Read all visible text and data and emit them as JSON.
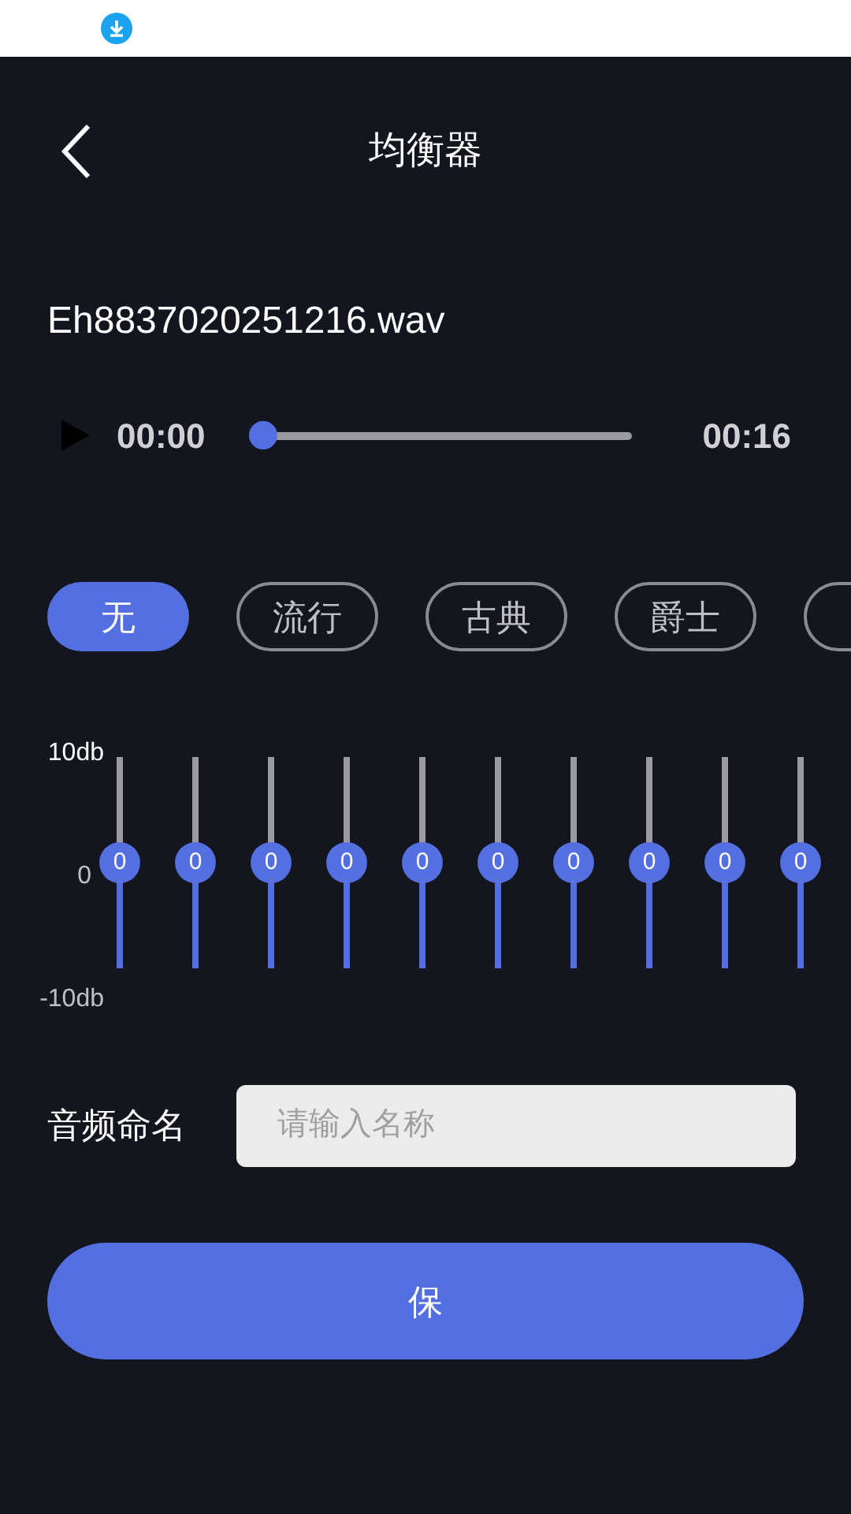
{
  "header": {
    "title": "均衡器"
  },
  "player": {
    "filename": "Eh8837020251216.wav",
    "current_time": "00:00",
    "level": 0,
    "duration": "00:16"
  },
  "presets": [
    {
      "label": "无",
      "selected": true
    },
    {
      "label": "流行",
      "selected": false
    },
    {
      "label": "古典",
      "selected": false
    },
    {
      "label": "爵士",
      "selected": false
    },
    {
      "selected": false
    }
  ],
  "equalizer": {
    "max_label": "10db",
    "mid_label": "0",
    "min_label": "-10db",
    "bands": [
      {
        "value": "0",
        "level": 0.5
      },
      {
        "value": "0",
        "level": 0.5
      },
      {
        "value": "0",
        "level": 0.5
      },
      {
        "value": "0",
        "level": 0.5
      },
      {
        "value": "0",
        "level": 0.5
      },
      {
        "value": "0",
        "level": 0.5
      },
      {
        "value": "0",
        "level": 0.5
      },
      {
        "value": "0",
        "level": 0.5
      },
      {
        "value": "0",
        "level": 0.5
      },
      {
        "value": "0",
        "level": 0.5
      }
    ]
  },
  "name_field": {
    "label": "音频命名",
    "placeholder": "请输入名称"
  },
  "save_button": {
    "label": "保"
  }
}
